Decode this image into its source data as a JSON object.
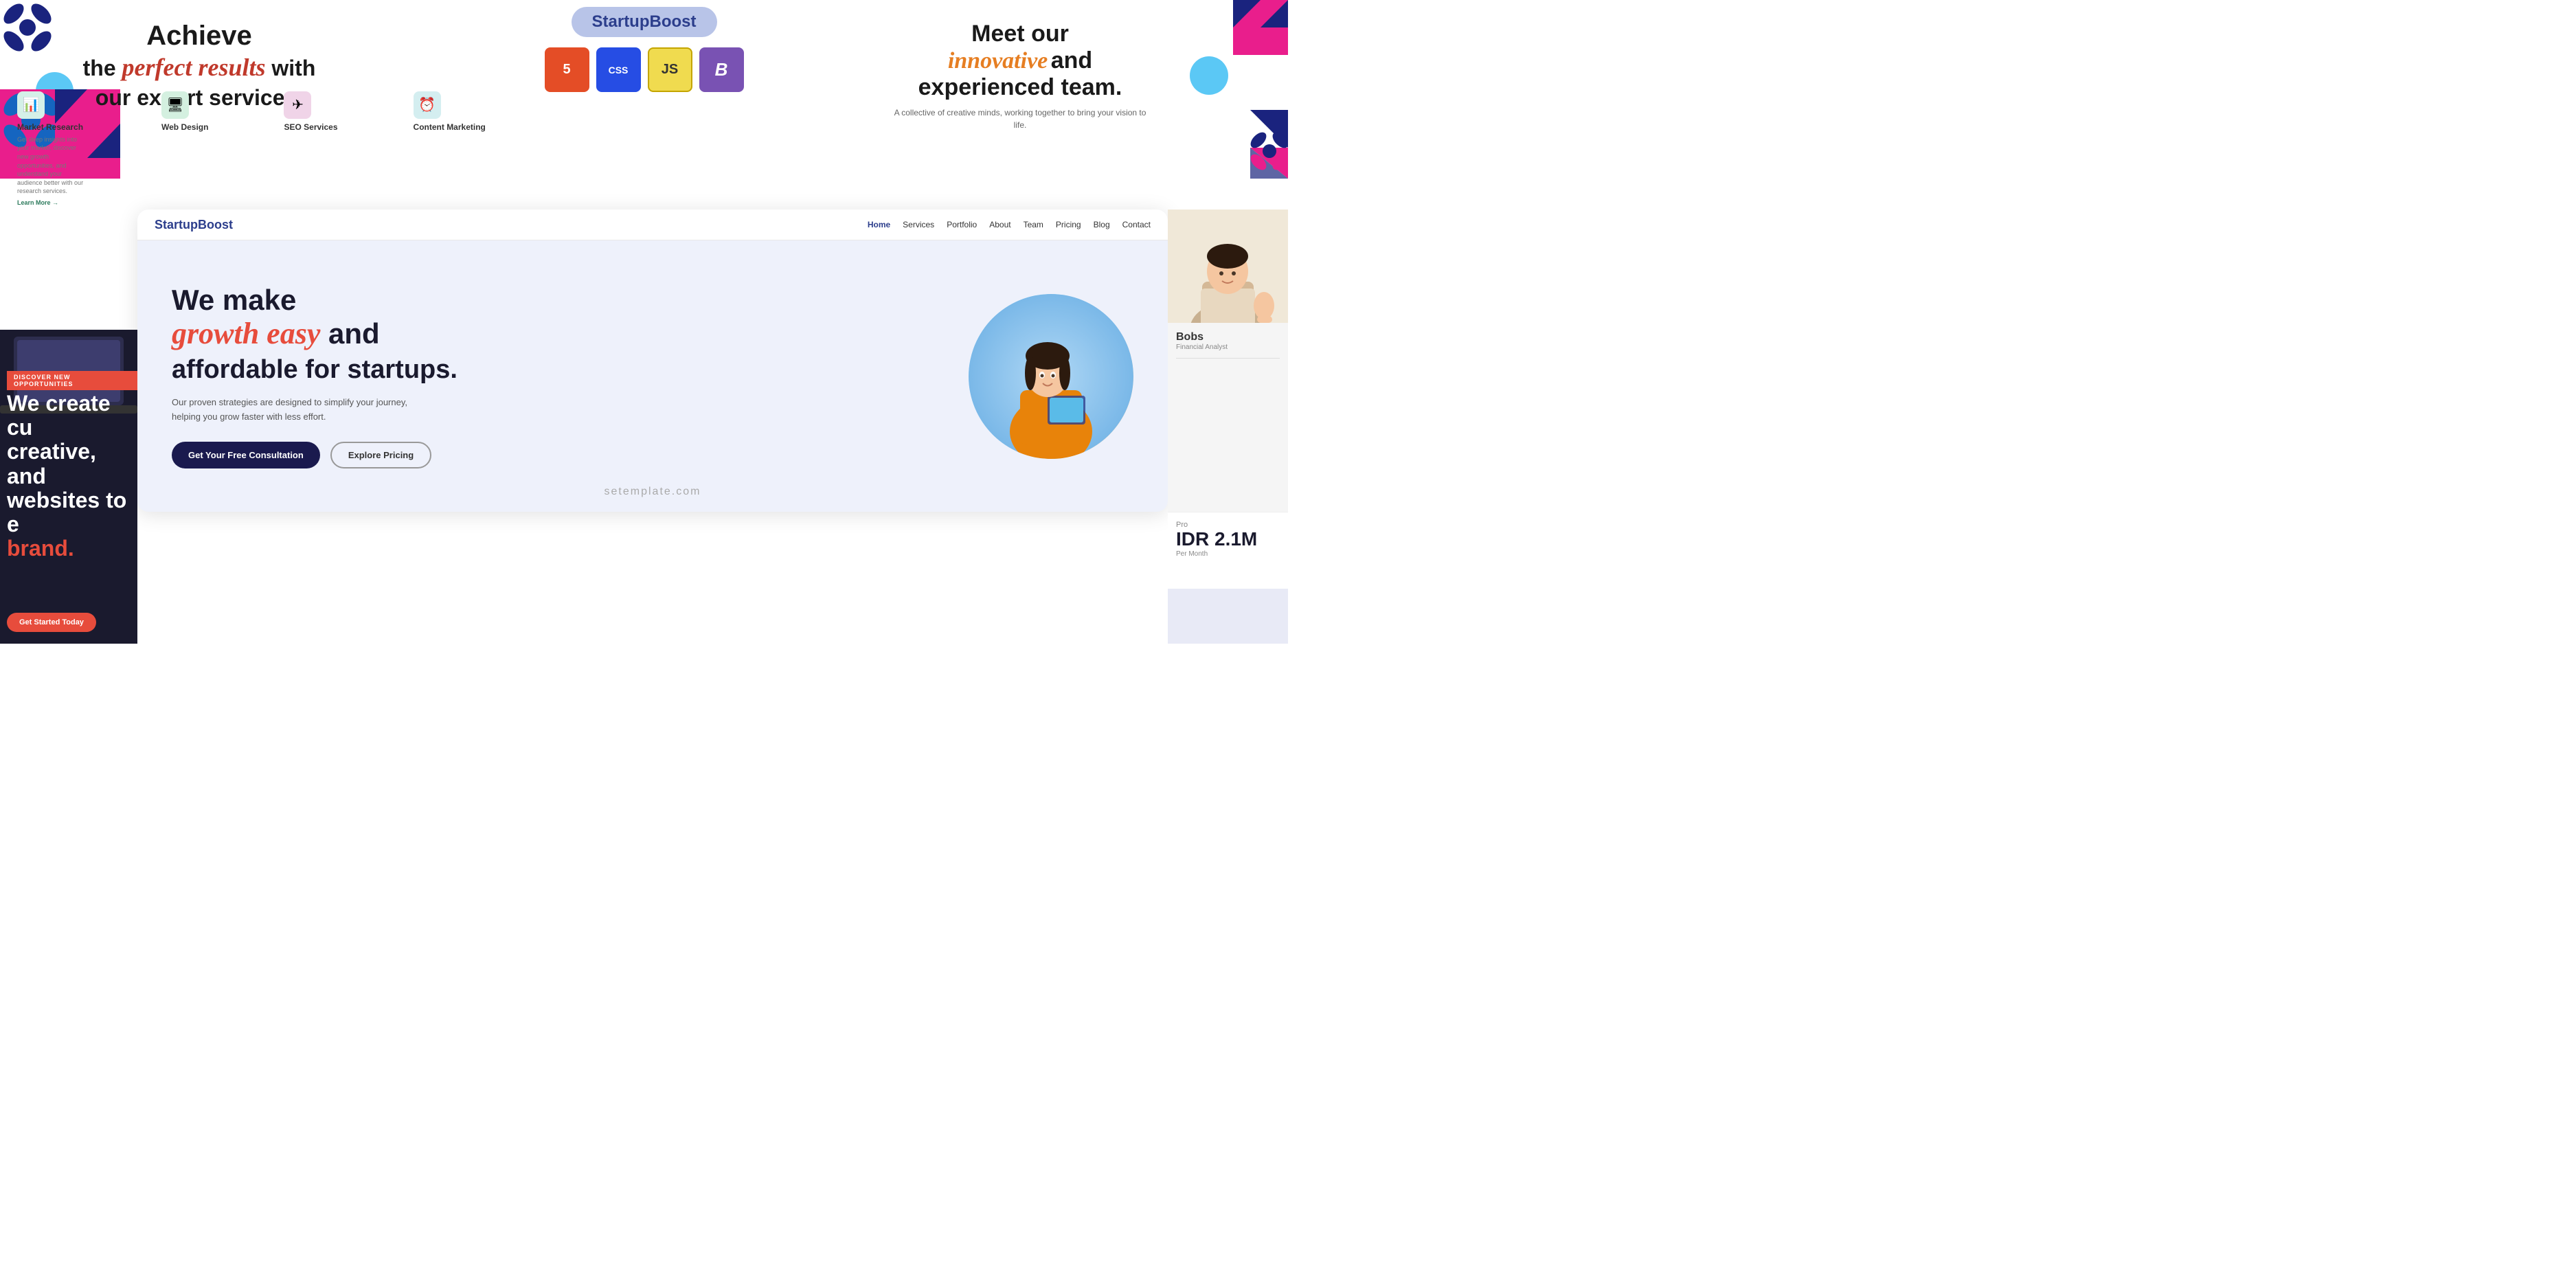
{
  "brand": {
    "name": "StartupBoost",
    "pill_label": "StartupBoost",
    "color": "#2c3e8c"
  },
  "top_left_headline": {
    "line1": "Achieve",
    "line2_start": "the ",
    "line2_cursive": "perfect results",
    "line2_end": " with",
    "line3": "our expert services."
  },
  "top_right_headline": {
    "line1": "Meet our",
    "cursive": "innovative",
    "and_text": " and",
    "line3": "experienced team.",
    "subtitle": "A collective of creative minds, working together to bring your vision to life."
  },
  "tech_icons": [
    {
      "label": "HTML5",
      "short": "H5",
      "class": "html"
    },
    {
      "label": "CSS3",
      "short": "CSS",
      "class": "css"
    },
    {
      "label": "JavaScript",
      "short": "JS",
      "class": "js"
    },
    {
      "label": "Bootstrap",
      "short": "B",
      "class": "bootstrap"
    }
  ],
  "services": [
    {
      "name": "Market Research",
      "desc": "Get deep insights into your market, discover new growth opportunities, and understand your audience better with our research services.",
      "learn": "Learn More →",
      "icon_type": "teal",
      "icon_glyph": "📊"
    },
    {
      "name": "Web Design",
      "desc": "",
      "icon_type": "green",
      "icon_glyph": "🖥️"
    },
    {
      "name": "SEO Services",
      "desc": "",
      "icon_type": "pink",
      "icon_glyph": "✈"
    },
    {
      "name": "Content Marketing",
      "desc": "",
      "icon_type": "mint",
      "icon_glyph": "⏰"
    }
  ],
  "nav": {
    "brand": "StartupBoost",
    "links": [
      {
        "label": "Home",
        "active": true
      },
      {
        "label": "Services",
        "active": false
      },
      {
        "label": "Portfolio",
        "active": false
      },
      {
        "label": "About",
        "active": false
      },
      {
        "label": "Team",
        "active": false
      },
      {
        "label": "Pricing",
        "active": false
      },
      {
        "label": "Blog",
        "active": false
      },
      {
        "label": "Contact",
        "active": false
      }
    ]
  },
  "hero": {
    "line1": "We make",
    "line2_cursive": "growth easy",
    "line2_end": " and",
    "line3": "affordable for startups.",
    "subtitle": "Our proven strategies are designed to simplify your journey, helping you grow faster with less effort.",
    "btn_primary": "Get Your Free Consultation",
    "btn_outline": "Explore Pricing"
  },
  "watermark": "setemplate.com",
  "left_dark": {
    "discover_tag": "DISCOVER NEW OPPORTUNITIES",
    "big_text_1": "We create cu",
    "big_text_2": "creative, and",
    "big_text_3": "websites to e",
    "big_text_4": "brand.",
    "btn": "Get Started Today"
  },
  "team_member": {
    "name": "Bobs",
    "role": "Financial Analyst"
  },
  "pricing": {
    "plan": "Pro",
    "amount": "IDR 2.1M",
    "period": "Per Month"
  }
}
